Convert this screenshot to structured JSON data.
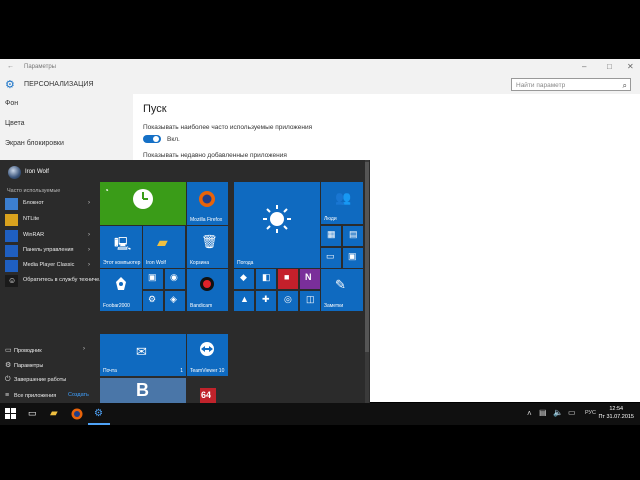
{
  "settings": {
    "window_title": "Параметры",
    "header_title": "ПЕРСОНАЛИЗАЦИЯ",
    "search_placeholder": "Найти параметр",
    "nav": [
      "Фон",
      "Цвета",
      "Экран блокировки"
    ],
    "section_title": "Пуск",
    "option1": "Показывать наиболее часто используемые приложения",
    "toggle_label": "Вкл.",
    "option2": "Показывать недавно добавленные приложения"
  },
  "start_menu": {
    "user_name": "Iron Wolf",
    "most_used_label": "Часто используемые",
    "apps": [
      {
        "label": "Блокнот",
        "arrow": true
      },
      {
        "label": "NTLite",
        "arrow": false
      },
      {
        "label": "WinRAR",
        "arrow": true
      },
      {
        "label": "Панель управления",
        "arrow": true
      },
      {
        "label": "Media Player Classic",
        "arrow": true
      },
      {
        "label": "Обратитесь в службу техниче...",
        "arrow": false
      }
    ],
    "bottom": [
      "Проводник",
      "Параметры",
      "Завершение работы",
      "Все приложения"
    ],
    "create_label": "Создать"
  },
  "tiles": {
    "firefox": "Mozilla Firefox",
    "this_pc": "Этот компьютер",
    "iron_wolf": "Iron Wolf",
    "recycle": "Корзина",
    "weather": "Погода",
    "people": "Люди",
    "foobar": "Foobar2000",
    "bandicam": "Bandicam",
    "notes": "Заметки",
    "mail": "Почта",
    "mail_count": "1",
    "teamviewer": "TeamViewer 10"
  },
  "taskbar": {
    "lang": "РУС",
    "time": "12:54",
    "date": "Пт 31.07.2015"
  },
  "colors": {
    "accent": "#0f6ac0",
    "green_tile": "#3a9c18",
    "start_bg": "#2b2b2b",
    "taskbar_bg": "#101010"
  }
}
